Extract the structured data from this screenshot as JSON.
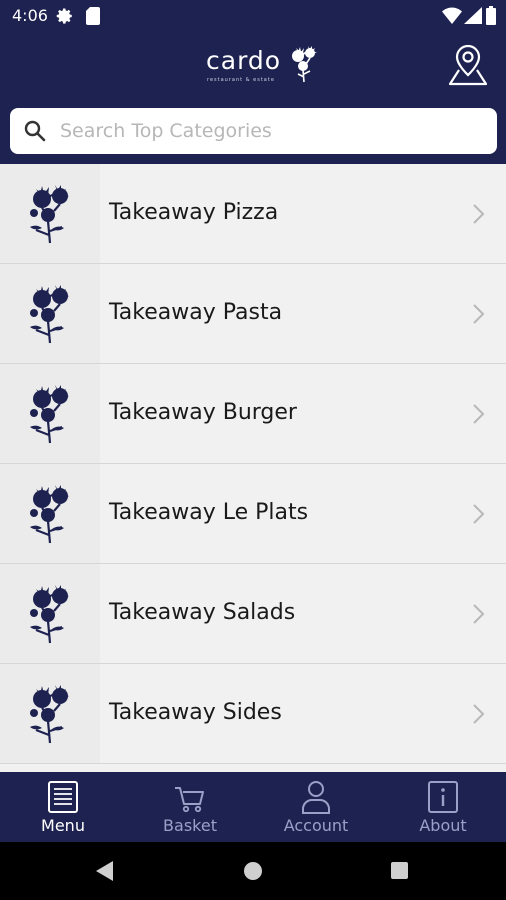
{
  "status_bar": {
    "time": "4:06",
    "icons": [
      "gear-icon",
      "sd-card-icon",
      "wifi-icon",
      "signal-icon",
      "battery-icon"
    ]
  },
  "header": {
    "logo_text": "cardo",
    "logo_subtext": "restaurant & estate",
    "location_icon": "map-pin-icon"
  },
  "search": {
    "placeholder": "Search Top Categories",
    "value": ""
  },
  "categories": [
    {
      "label": "Takeaway Pizza"
    },
    {
      "label": "Takeaway Pasta"
    },
    {
      "label": "Takeaway Burger"
    },
    {
      "label": "Takeaway Le Plats"
    },
    {
      "label": "Takeaway Salads"
    },
    {
      "label": "Takeaway Sides"
    }
  ],
  "bottom_nav": {
    "items": [
      {
        "label": "Menu",
        "icon": "menu-book-icon",
        "active": true
      },
      {
        "label": "Basket",
        "icon": "cart-icon",
        "active": false
      },
      {
        "label": "Account",
        "icon": "person-icon",
        "active": false
      },
      {
        "label": "About",
        "icon": "info-icon",
        "active": false
      }
    ]
  },
  "colors": {
    "brand_navy": "#1e2250",
    "list_background": "#f1f1f1",
    "inactive_nav": "#9aa0c8"
  }
}
